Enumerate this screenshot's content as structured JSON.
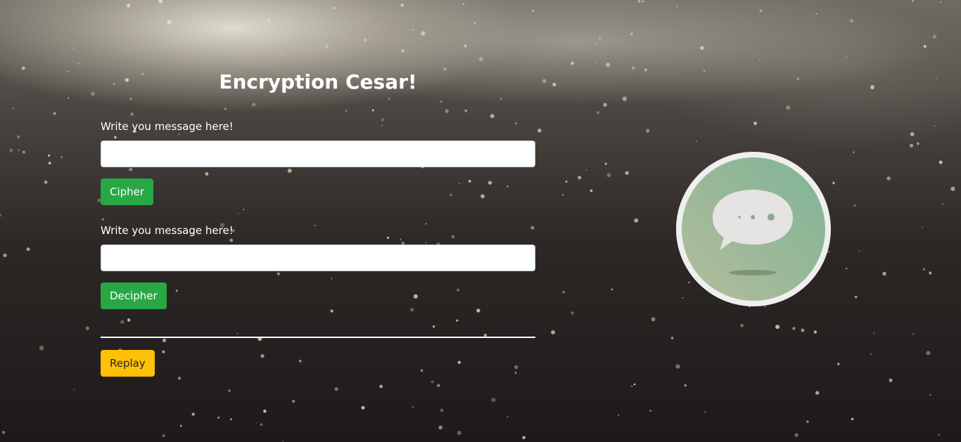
{
  "page": {
    "title": "Encryption Cesar!"
  },
  "cipher_form": {
    "label": "Write you message here!",
    "input_value": "",
    "button_label": "Cipher"
  },
  "decipher_form": {
    "label": "Write you message here!",
    "input_value": "",
    "button_label": "Decipher"
  },
  "replay": {
    "button_label": "Replay"
  },
  "illustration": {
    "icon": "chat-bubble-icon",
    "circle_color": "#8db89a",
    "border_color": "#f0f0f0"
  },
  "colors": {
    "cipher_button": "#28a745",
    "replay_button": "#ffc107"
  }
}
